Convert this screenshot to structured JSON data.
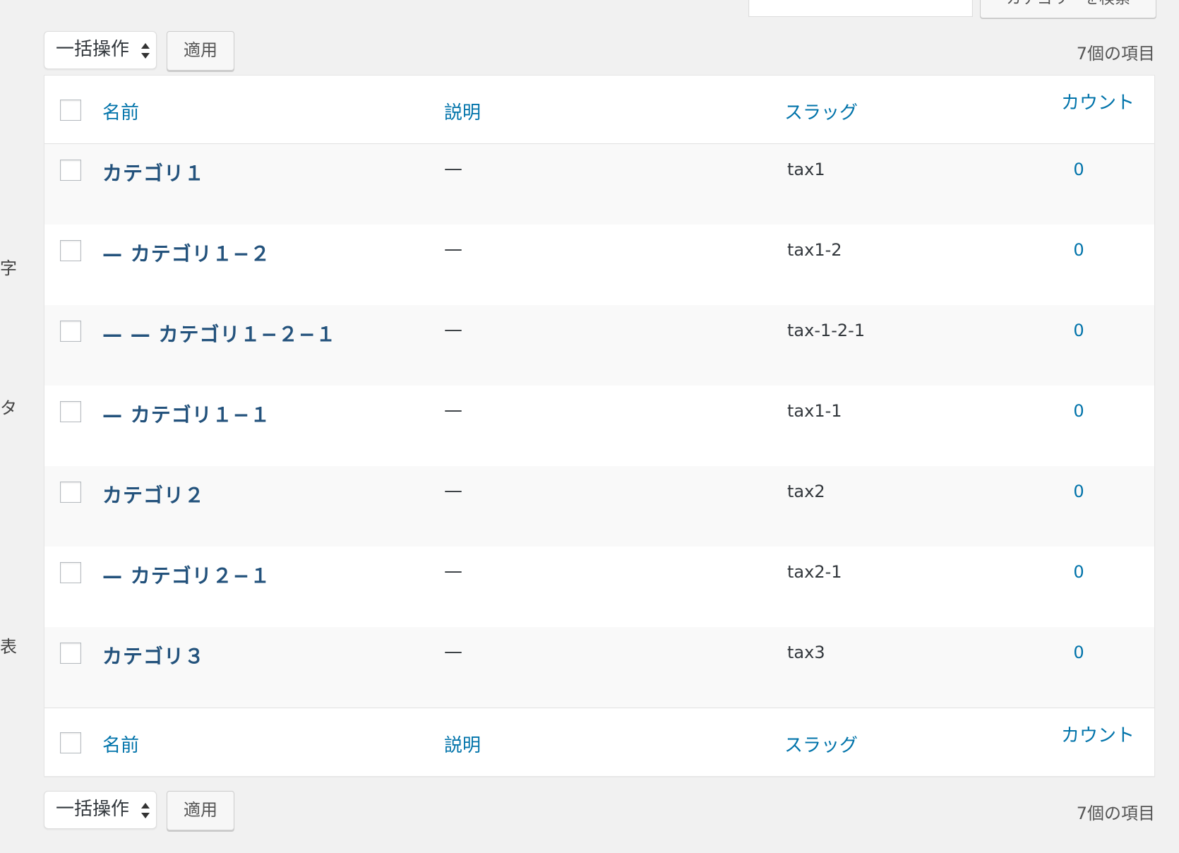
{
  "search": {
    "button_label": "カテゴリーを検索"
  },
  "left_labels": [
    "字",
    "タ",
    "表"
  ],
  "tablenav_top": {
    "bulk_action": "一括操作",
    "apply_label": "適用",
    "item_count": "7個の項目"
  },
  "tablenav_bottom": {
    "bulk_action": "一括操作",
    "apply_label": "適用",
    "item_count": "7個の項目"
  },
  "table": {
    "columns": {
      "name": "名前",
      "description": "説明",
      "slug": "スラッグ",
      "count": "カウント"
    },
    "rows": [
      {
        "name": "カテゴリ１",
        "description": "—",
        "slug": "tax1",
        "count": "0"
      },
      {
        "name": "— カテゴリ１−２",
        "description": "—",
        "slug": "tax1-2",
        "count": "0"
      },
      {
        "name": "— — カテゴリ１−２−１",
        "description": "—",
        "slug": "tax-1-2-1",
        "count": "0"
      },
      {
        "name": "— カテゴリ１−１",
        "description": "—",
        "slug": "tax1-1",
        "count": "0"
      },
      {
        "name": "カテゴリ２",
        "description": "—",
        "slug": "tax2",
        "count": "0"
      },
      {
        "name": "— カテゴリ２−１",
        "description": "—",
        "slug": "tax2-1",
        "count": "0"
      },
      {
        "name": "カテゴリ３",
        "description": "—",
        "slug": "tax3",
        "count": "0"
      }
    ]
  },
  "colors": {
    "link": "#0073aa",
    "row_title": "#23527c",
    "background": "#f1f1f1",
    "row_alt": "#f9f9f9"
  }
}
